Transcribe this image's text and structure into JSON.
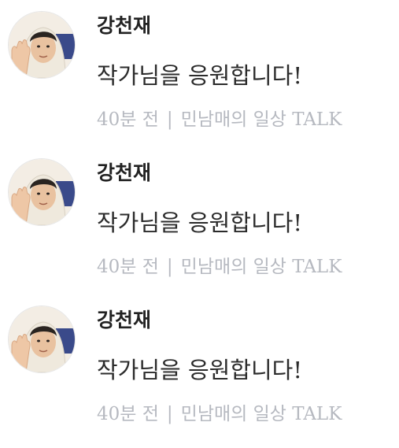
{
  "comments": [
    {
      "author": "강천재",
      "text": "작가님을 응원합니다!",
      "time": "40분 전",
      "separator": "|",
      "source": "민남매의 일상 TALK"
    },
    {
      "author": "강천재",
      "text": "작가님을 응원합니다!",
      "time": "40분 전",
      "separator": "|",
      "source": "민남매의 일상 TALK"
    },
    {
      "author": "강천재",
      "text": "작가님을 응원합니다!",
      "time": "40분 전",
      "separator": "|",
      "source": "민남매의 일상 TALK"
    }
  ],
  "colors": {
    "author": "#222222",
    "text": "#2b2b2b",
    "meta": "#b6b9c0"
  },
  "icons": {
    "avatar": "avatar-photo"
  }
}
